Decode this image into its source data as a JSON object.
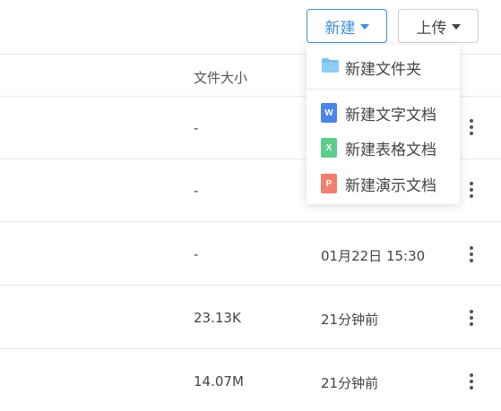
{
  "toolbar": {
    "new_label": "新建",
    "upload_label": "上传"
  },
  "table": {
    "header_size": "文件大小",
    "rows": [
      {
        "size": "-",
        "time": ""
      },
      {
        "size": "-",
        "time": ""
      },
      {
        "size": "-",
        "time": "01月22日 15:30"
      },
      {
        "size": "23.13K",
        "time": "21分钟前"
      },
      {
        "size": "14.07M",
        "time": "21分钟前"
      }
    ]
  },
  "dropdown": {
    "items": [
      {
        "label": "新建文件夹",
        "icon": "folder-icon"
      },
      {
        "label": "新建文字文档",
        "icon": "word-doc-icon",
        "glyph": "W"
      },
      {
        "label": "新建表格文档",
        "icon": "spreadsheet-icon",
        "glyph": "X"
      },
      {
        "label": "新建演示文档",
        "icon": "presentation-icon",
        "glyph": "P"
      }
    ]
  },
  "colors": {
    "accent": "#3f8fd8",
    "folder": "#7cc0f0",
    "word": "#4a86e8",
    "sheet": "#5ccd8a",
    "ppt": "#f27e6e"
  }
}
